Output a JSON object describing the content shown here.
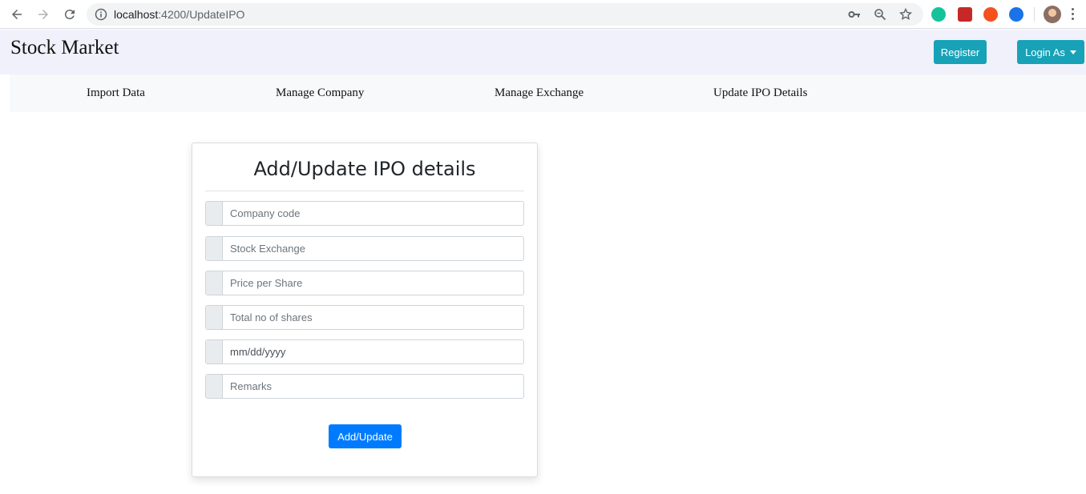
{
  "browser": {
    "url_host": "localhost",
    "url_path": ":4200/UpdateIPO"
  },
  "header": {
    "brand": "Stock Market",
    "register_label": "Register",
    "login_label": "Login As"
  },
  "subnav": {
    "items": [
      {
        "label": "Import Data"
      },
      {
        "label": "Manage Company"
      },
      {
        "label": "Manage Exchange"
      },
      {
        "label": "Update IPO Details"
      }
    ]
  },
  "form": {
    "title": "Add/Update IPO details",
    "fields": [
      {
        "placeholder": "Company code"
      },
      {
        "placeholder": "Stock Exchange"
      },
      {
        "placeholder": "Price per Share"
      },
      {
        "placeholder": "Total no of shares"
      },
      {
        "placeholder": "mm/dd/yyyy"
      },
      {
        "placeholder": "Remarks"
      }
    ],
    "submit_label": "Add/Update"
  },
  "colors": {
    "header_bg": "#f0f1fa",
    "info": "#17a2b8",
    "primary": "#007bff"
  }
}
